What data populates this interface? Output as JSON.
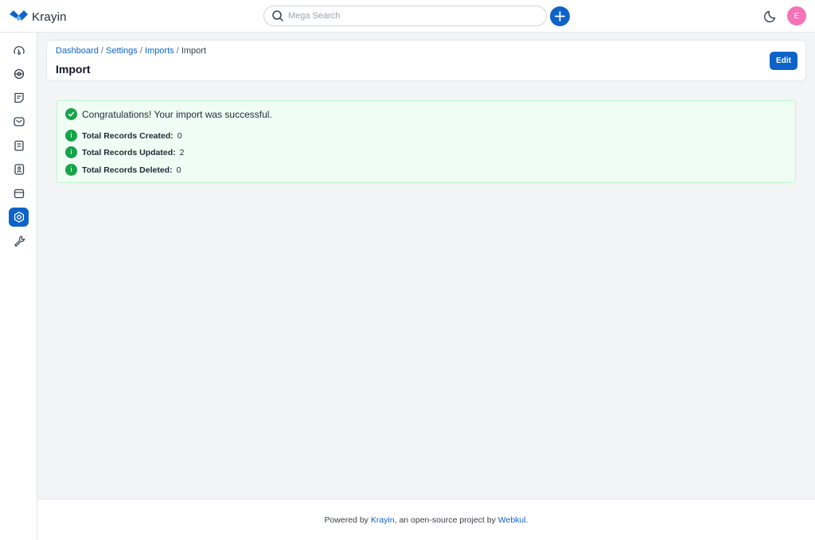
{
  "app": {
    "name": "Krayin"
  },
  "search": {
    "placeholder": "Mega Search"
  },
  "user": {
    "initial": "E",
    "avatar_color": "#f472b6"
  },
  "colors": {
    "accent": "#0e63c9",
    "success": "#16a34a",
    "success_bg": "#f0fdf4"
  },
  "sidebar": {
    "items": [
      {
        "name": "dashboard",
        "icon": "dashboard-gauge-icon",
        "active": false
      },
      {
        "name": "leads",
        "icon": "leads-icon",
        "active": false
      },
      {
        "name": "quotes",
        "icon": "quotes-icon",
        "active": false
      },
      {
        "name": "mail",
        "icon": "mail-icon",
        "active": false
      },
      {
        "name": "activities",
        "icon": "activities-icon",
        "active": false
      },
      {
        "name": "contacts",
        "icon": "contacts-icon",
        "active": false
      },
      {
        "name": "products",
        "icon": "products-icon",
        "active": false
      },
      {
        "name": "settings",
        "icon": "settings-icon",
        "active": true
      },
      {
        "name": "configuration",
        "icon": "wrench-icon",
        "active": false
      }
    ]
  },
  "breadcrumb": {
    "items": [
      "Dashboard",
      "Settings",
      "Imports"
    ],
    "separator": "/",
    "current": "Import"
  },
  "page": {
    "title": "Import",
    "edit_label": "Edit"
  },
  "alert": {
    "message": "Congratulations! Your import was successful.",
    "stats": [
      {
        "label": "Total Records Created:",
        "value": "0"
      },
      {
        "label": "Total Records Updated:",
        "value": "2"
      },
      {
        "label": "Total Records Deleted:",
        "value": "0"
      }
    ],
    "info_glyph": "i"
  },
  "footer": {
    "prefix": "Powered by",
    "brand": "Krayin",
    "middle": ", an open-source project by",
    "company": "Webkul",
    "suffix": "."
  }
}
